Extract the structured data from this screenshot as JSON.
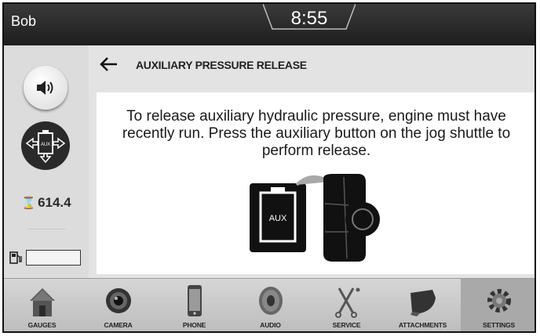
{
  "header": {
    "user": "Bob",
    "time": "8:55"
  },
  "status": {
    "hours": "614.4",
    "fuel_level": 0
  },
  "page": {
    "title": "AUXILIARY PRESSURE RELEASE",
    "message": "To release auxiliary hydraulic pressure, engine must have recently run. Press the auxiliary button on the jog shuttle to perform release.",
    "illustration_label": "AUX"
  },
  "nav": {
    "items": [
      {
        "label": "GAUGES",
        "icon": "home-icon"
      },
      {
        "label": "CAMERA",
        "icon": "camera-icon"
      },
      {
        "label": "PHONE",
        "icon": "phone-icon"
      },
      {
        "label": "AUDIO",
        "icon": "speaker-icon"
      },
      {
        "label": "SERVICE",
        "icon": "wrench-icon"
      },
      {
        "label": "ATTACHMENTS",
        "icon": "bucket-icon"
      },
      {
        "label": "SETTINGS",
        "icon": "gear-icon",
        "active": true
      }
    ]
  },
  "colors": {
    "topbar": "#2a2a2a",
    "background": "#e3e3e3",
    "card": "#ffffff",
    "active_nav": "#a9a9a9"
  }
}
